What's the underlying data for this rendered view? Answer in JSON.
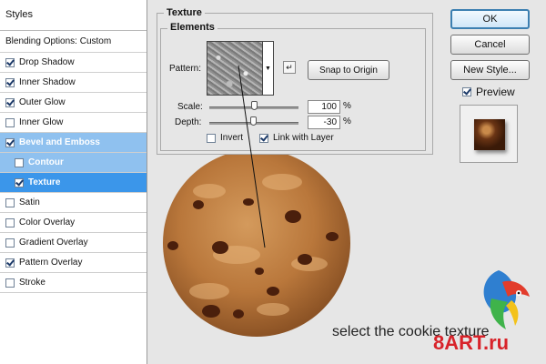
{
  "styles_panel": {
    "header": "Styles",
    "items": [
      {
        "label": "Blending Options: Custom",
        "has_checkbox": false,
        "checked": false
      },
      {
        "label": "Drop Shadow",
        "has_checkbox": true,
        "checked": true
      },
      {
        "label": "Inner Shadow",
        "has_checkbox": true,
        "checked": true
      },
      {
        "label": "Outer Glow",
        "has_checkbox": true,
        "checked": true
      },
      {
        "label": "Inner Glow",
        "has_checkbox": true,
        "checked": false
      },
      {
        "label": "Bevel and Emboss",
        "has_checkbox": true,
        "checked": true
      },
      {
        "label": "Contour",
        "has_checkbox": true,
        "checked": false
      },
      {
        "label": "Texture",
        "has_checkbox": true,
        "checked": true
      },
      {
        "label": "Satin",
        "has_checkbox": true,
        "checked": false
      },
      {
        "label": "Color Overlay",
        "has_checkbox": true,
        "checked": false
      },
      {
        "label": "Gradient Overlay",
        "has_checkbox": true,
        "checked": false
      },
      {
        "label": "Pattern Overlay",
        "has_checkbox": true,
        "checked": true
      },
      {
        "label": "Stroke",
        "has_checkbox": true,
        "checked": false
      }
    ]
  },
  "texture": {
    "group_title": "Texture",
    "elements_title": "Elements",
    "pattern_label": "Pattern:",
    "snap_button": "Snap to Origin",
    "scale_label": "Scale:",
    "scale_value": "100",
    "scale_percent": 100,
    "depth_label": "Depth:",
    "depth_value": "-30",
    "depth_percent": -30,
    "percent_sign": "%",
    "invert_label": "Invert",
    "invert_checked": false,
    "link_label": "Link with Layer",
    "link_checked": true
  },
  "buttons": {
    "ok": "OK",
    "cancel": "Cancel",
    "new_style": "New Style...",
    "preview_label": "Preview",
    "preview_checked": true
  },
  "caption": "select the cookie texture",
  "logo": "8ART.ru",
  "colors": {
    "selection_strong": "#3b96ea",
    "selection_light": "#8fc1ef",
    "logo_red": "#d8232a"
  }
}
